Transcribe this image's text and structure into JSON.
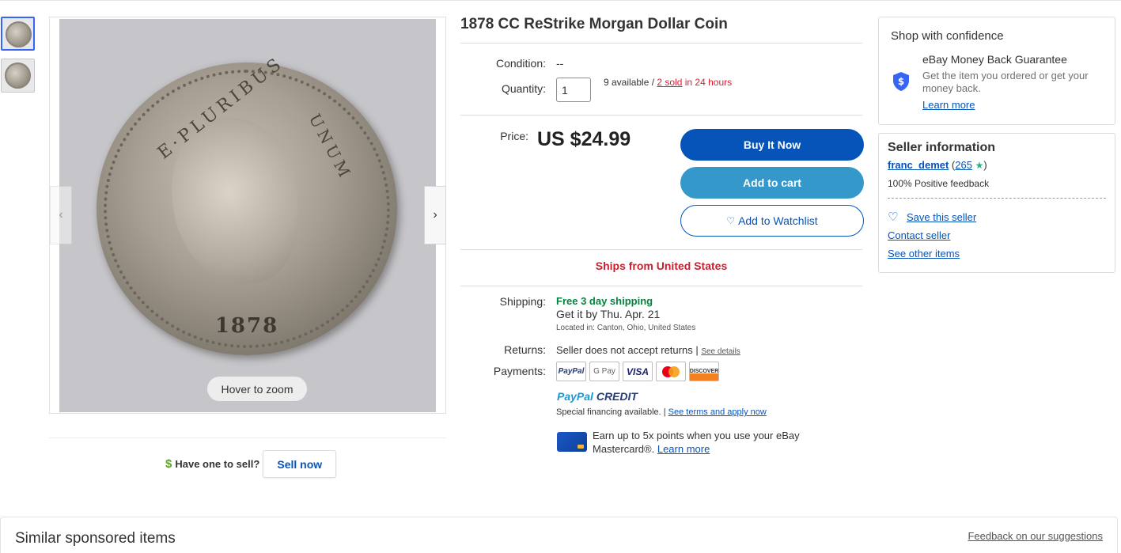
{
  "product": {
    "title": "1878 CC ReStrike Morgan Dollar Coin",
    "image_zoom_hint": "Hover to zoom",
    "coin_year_text": "1878",
    "coin_legend_left": "E·PLURIBUS",
    "coin_legend_right": "UNUM"
  },
  "sell": {
    "have_one": "Have one to sell?",
    "sell_now": "Sell now"
  },
  "purchase": {
    "condition_label": "Condition:",
    "condition_value": "--",
    "quantity_label": "Quantity:",
    "quantity_value": "1",
    "available_text": "9 available / ",
    "sold_text": "2 sold",
    "sold_window": " in 24 hours",
    "price_label": "Price:",
    "price_value": "US $24.99",
    "buy_now": "Buy It Now",
    "add_to_cart": "Add to cart",
    "add_to_watchlist": "Add to Watchlist",
    "ships_from": "Ships from United States"
  },
  "shipping": {
    "shipping_label": "Shipping:",
    "free_shipping": "Free 3 day shipping",
    "get_it_by": "Get it by Thu. Apr. 21",
    "located_in": "Located in:  Canton, Ohio, United States",
    "returns_label": "Returns:",
    "returns_value": "Seller does not accept returns |",
    "see_details": "See details",
    "payments_label": "Payments:",
    "payment_methods": [
      "PayPal",
      "G Pay",
      "VISA",
      "mastercard-icon",
      "DISCOVER"
    ],
    "paypal_credit": "PayPal",
    "paypal_credit_2": " CREDIT",
    "financing": "Special financing available. | ",
    "see_terms": "See terms and apply now",
    "earn_points": "Earn up to 5x points when you use your eBay Mastercard®.",
    "learn_more": "Learn more"
  },
  "confidence": {
    "title": "Shop with confidence",
    "guarantee_title": "eBay Money Back Guarantee",
    "guarantee_desc": "Get the item you ordered or get your money back.",
    "learn_more": "Learn more"
  },
  "seller": {
    "title": "Seller information",
    "name": "franc_demet",
    "feedback_score": "265",
    "positive_feedback": "100% Positive feedback",
    "save_seller": "Save this seller",
    "contact_seller": "Contact seller",
    "see_other_items": "See other items"
  },
  "bottom": {
    "similar_sponsored": "Similar sponsored items",
    "feedback_link": "Feedback on our suggestions"
  },
  "colors": {
    "primary_blue": "#0654ba",
    "cart_blue": "#3498ca",
    "ships_red": "#c5212f",
    "free_green": "#05823f"
  }
}
